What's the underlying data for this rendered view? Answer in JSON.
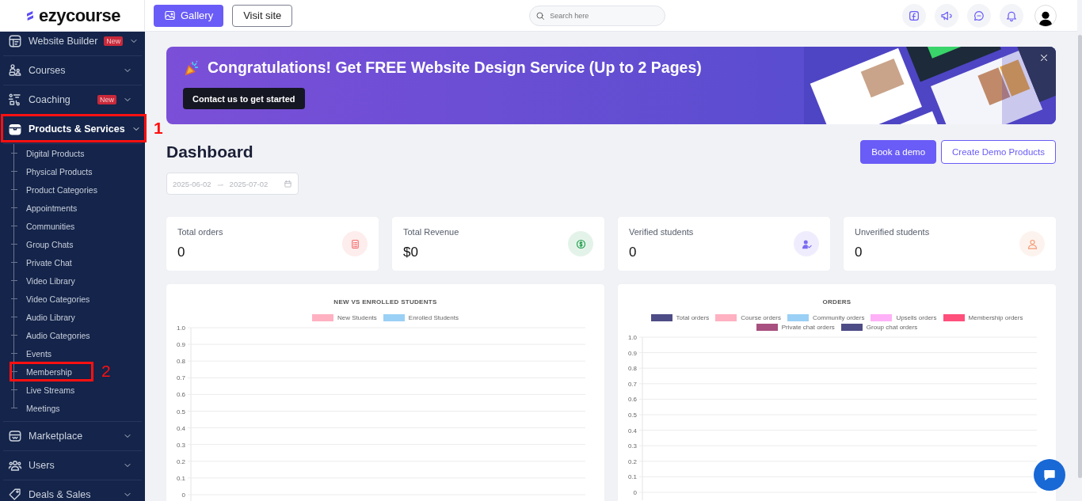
{
  "brand": {
    "name": "ezycourse"
  },
  "topbar": {
    "buttons": [
      {
        "label": "Gallery",
        "kind": "primary"
      },
      {
        "label": "Visit site",
        "kind": "outline"
      }
    ],
    "search": {
      "placeholder": "Search here"
    }
  },
  "sidebar": {
    "items": [
      {
        "label": "Website Builder",
        "badge": "New",
        "selected": false
      },
      {
        "label": "Courses",
        "selected": false
      },
      {
        "label": "Coaching",
        "badge": "New",
        "selected": false
      },
      {
        "label": "Products & Services",
        "selected": true,
        "annotation": "1",
        "children": [
          {
            "label": "Digital Products"
          },
          {
            "label": "Physical Products"
          },
          {
            "label": "Product Categories"
          },
          {
            "label": "Appointments"
          },
          {
            "label": "Communities"
          },
          {
            "label": "Group Chats"
          },
          {
            "label": "Private Chat"
          },
          {
            "label": "Video Library"
          },
          {
            "label": "Video Categories"
          },
          {
            "label": "Audio Library"
          },
          {
            "label": "Audio Categories"
          },
          {
            "label": "Events"
          },
          {
            "label": "Membership",
            "annotation": "2"
          },
          {
            "label": "Live Streams"
          },
          {
            "label": "Meetings"
          }
        ]
      },
      {
        "label": "Marketplace",
        "selected": false
      },
      {
        "label": "Users",
        "selected": false
      },
      {
        "label": "Deals & Sales",
        "selected": false
      }
    ]
  },
  "banner": {
    "title": "Congratulations! Get FREE Website Design Service (Up to 2 Pages)",
    "button": "Contact us to get started"
  },
  "page": {
    "title": "Dashboard",
    "buttons": [
      {
        "label": "Book a demo",
        "kind": "primary"
      },
      {
        "label": "Create Demo Products",
        "kind": "outline"
      }
    ],
    "date_range": {
      "start": "2025-06-02",
      "end": "2025-07-02"
    }
  },
  "stats": [
    {
      "label": "Total orders",
      "value": "0",
      "color": "#f36f6f"
    },
    {
      "label": "Total Revenue",
      "value": "$0",
      "color": "#1f9d4c"
    },
    {
      "label": "Verified students",
      "value": "0",
      "color": "#7b6cf2"
    },
    {
      "label": "Unverified students",
      "value": "0",
      "color": "#f29a72"
    }
  ],
  "charts": [
    {
      "chart_data": {
        "type": "line",
        "title": "NEW VS ENROLLED STUDENTS",
        "grid": true,
        "ylim": [
          0,
          1
        ],
        "yticks": [
          {
            "value": 1,
            "label": "1.0"
          },
          {
            "value": 0.9,
            "label": "0.9"
          },
          {
            "value": 0.8,
            "label": "0.8"
          },
          {
            "value": 0.7,
            "label": "0.7"
          },
          {
            "value": 0.6,
            "label": "0.6"
          },
          {
            "value": 0.5,
            "label": "0.5"
          },
          {
            "value": 0.4,
            "label": "0.4"
          },
          {
            "value": 0.3,
            "label": "0.3"
          },
          {
            "value": 0.2,
            "label": "0.2"
          },
          {
            "value": 0.1,
            "label": "0.1"
          },
          {
            "value": 0,
            "label": "0"
          }
        ],
        "series": [
          {
            "name": "New Students",
            "color": "#ffb1c1"
          },
          {
            "name": "Enrolled Students",
            "color": "#9ad0f5"
          }
        ]
      }
    },
    {
      "chart_data": {
        "type": "line",
        "title": "ORDERS",
        "grid": true,
        "ylim": [
          0,
          1
        ],
        "yticks": [
          {
            "value": 1,
            "label": "1.0"
          },
          {
            "value": 0.9,
            "label": "0.9"
          },
          {
            "value": 0.8,
            "label": "0.8"
          },
          {
            "value": 0.7,
            "label": "0.7"
          },
          {
            "value": 0.6,
            "label": "0.6"
          },
          {
            "value": 0.5,
            "label": "0.5"
          },
          {
            "value": 0.4,
            "label": "0.4"
          },
          {
            "value": 0.3,
            "label": "0.3"
          },
          {
            "value": 0.2,
            "label": "0.2"
          },
          {
            "value": 0.1,
            "label": "0.1"
          },
          {
            "value": 0,
            "label": "0"
          }
        ],
        "series": [
          {
            "name": "Total orders",
            "color": "#4e4c86"
          },
          {
            "name": "Course orders",
            "color": "#ffb1c1"
          },
          {
            "name": "Community orders",
            "color": "#9ad0f5"
          },
          {
            "name": "Upsells orders",
            "color": "#ffb1f7"
          },
          {
            "name": "Membership orders",
            "color": "#ff4f7b"
          },
          {
            "name": "Private chat orders",
            "color": "#a8507f"
          },
          {
            "name": "Group chat orders",
            "color": "#4e4c86"
          }
        ]
      }
    }
  ]
}
